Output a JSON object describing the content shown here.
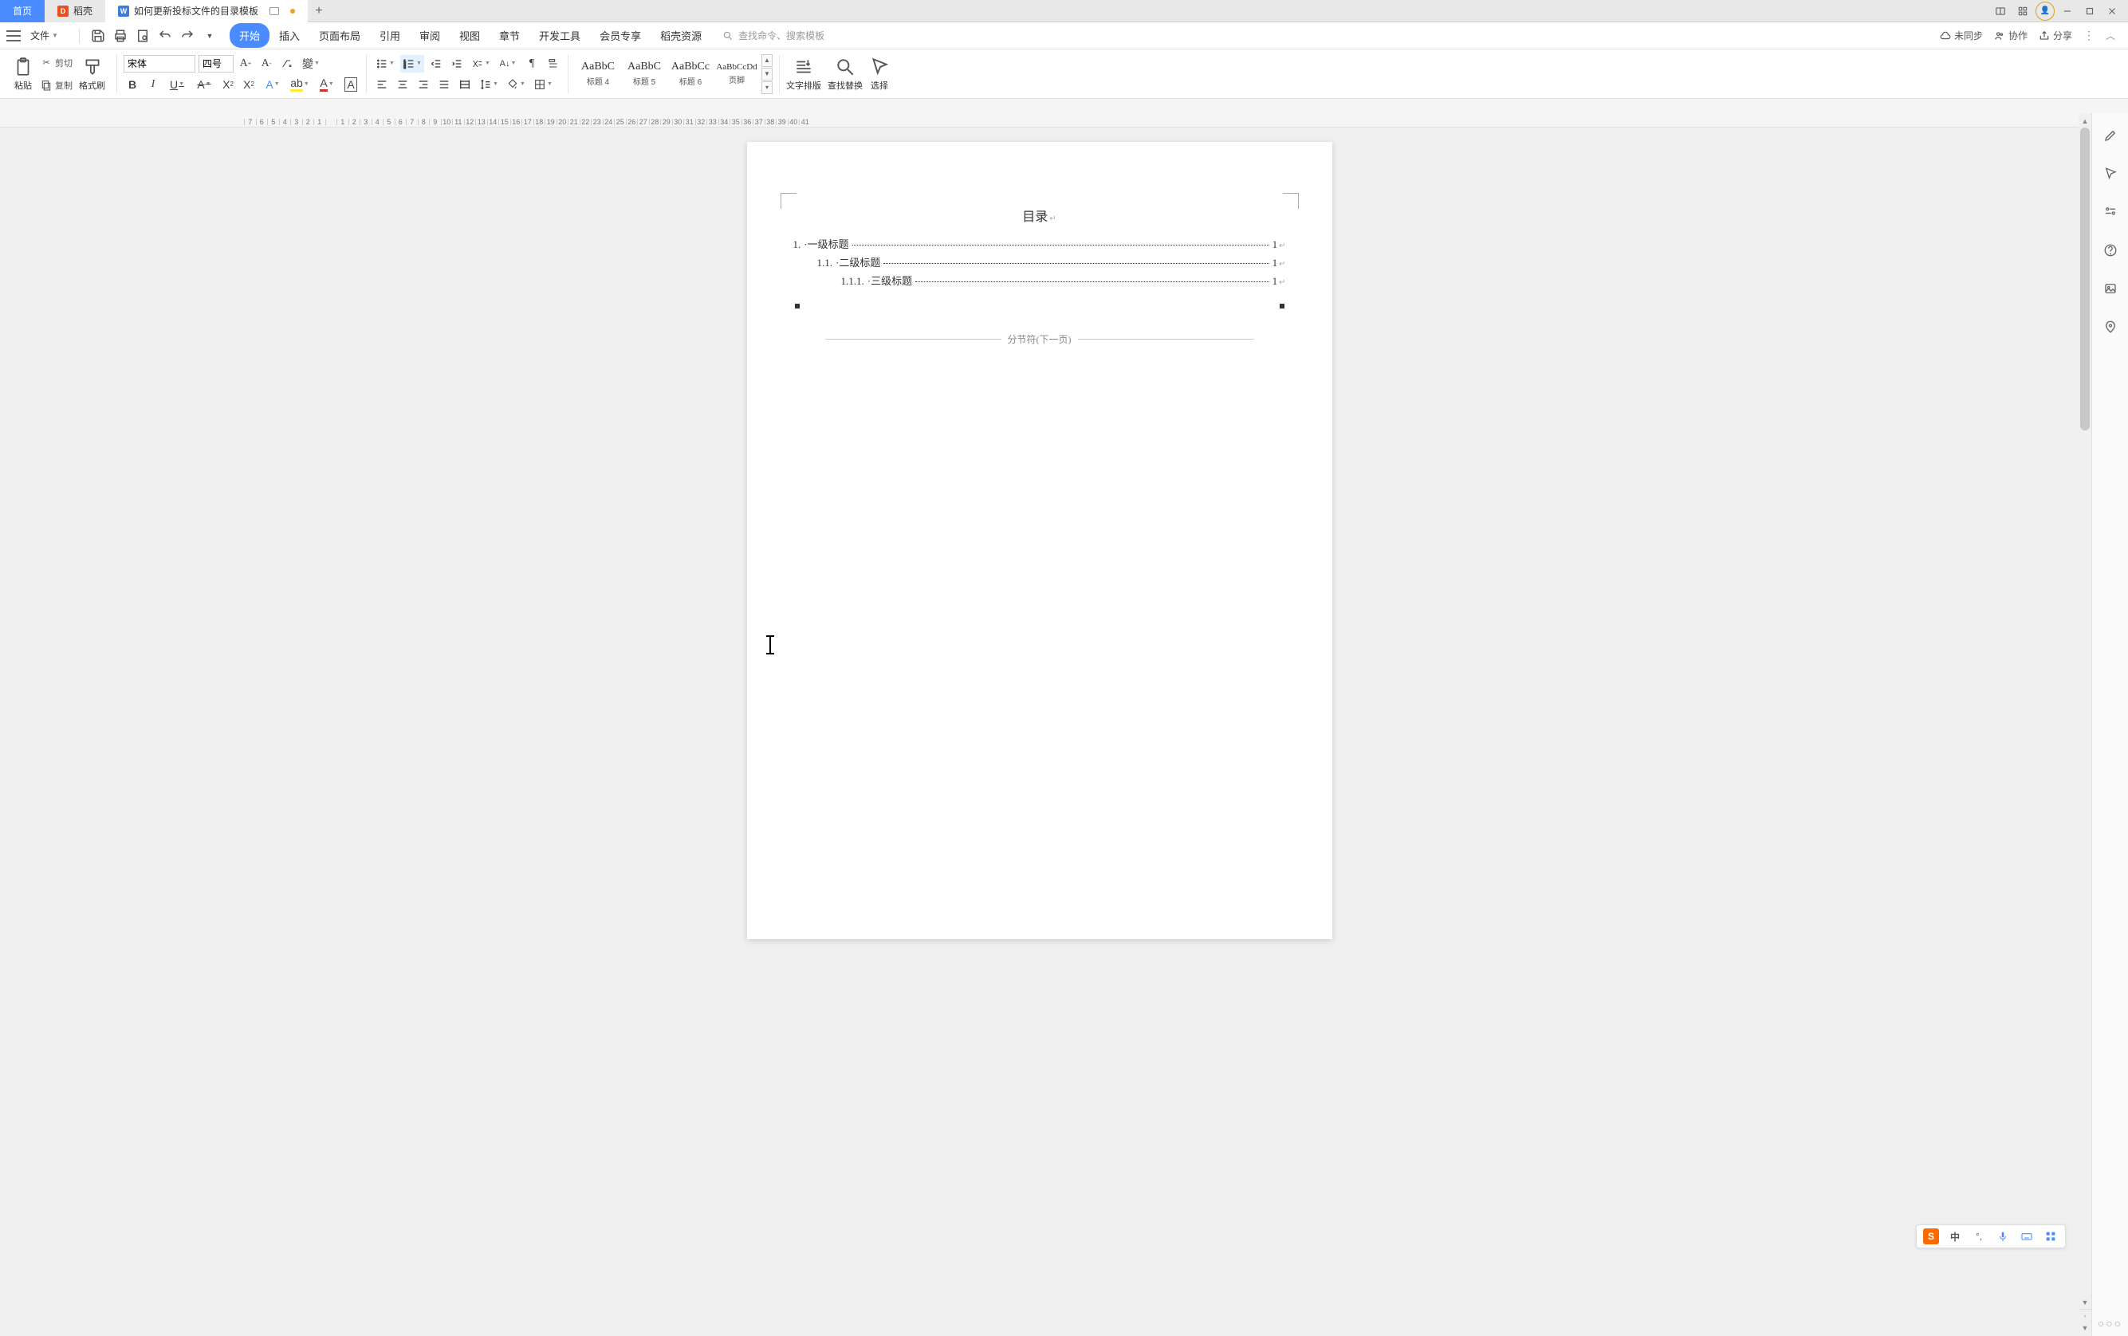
{
  "titlebar": {
    "home": "首页",
    "docer": "稻壳",
    "filename": "如何更新投标文件的目录模板",
    "add": "+"
  },
  "menubar": {
    "file": "文件",
    "tabs": [
      "开始",
      "插入",
      "页面布局",
      "引用",
      "审阅",
      "视图",
      "章节",
      "开发工具",
      "会员专享",
      "稻壳资源"
    ],
    "search_placeholder": "查找命令、搜索模板",
    "unsync": "未同步",
    "coop": "协作",
    "share": "分享"
  },
  "ribbon": {
    "paste": "粘贴",
    "cut": "剪切",
    "copy": "复制",
    "fmtpainter": "格式刷",
    "font_name": "宋体",
    "font_size": "四号",
    "styles": [
      {
        "prev": "AaBbC",
        "name": "标题 4"
      },
      {
        "prev": "AaBbC",
        "name": "标题 5"
      },
      {
        "prev": "AaBbCc",
        "name": "标题 6"
      },
      {
        "prev": "AaBbCcDd",
        "name": "页脚"
      }
    ],
    "textlayout": "文字排版",
    "findreplace": "查找替换",
    "select": "选择"
  },
  "ruler": [
    "7",
    "6",
    "5",
    "4",
    "3",
    "2",
    "1",
    "",
    "1",
    "2",
    "3",
    "4",
    "5",
    "6",
    "7",
    "8",
    "9",
    "10",
    "11",
    "12",
    "13",
    "14",
    "15",
    "16",
    "17",
    "18",
    "19",
    "20",
    "21",
    "22",
    "23",
    "24",
    "25",
    "26",
    "27",
    "28",
    "29",
    "30",
    "31",
    "32",
    "33",
    "34",
    "35",
    "36",
    "37",
    "38",
    "39",
    "40",
    "41"
  ],
  "doc": {
    "toc_title": "目录",
    "lines": [
      {
        "num": "1.",
        "txt": "·一级标题",
        "pg": "1"
      },
      {
        "num": "1.1.",
        "txt": "·二级标题",
        "pg": "1"
      },
      {
        "num": "1.1.1.",
        "txt": "·三级标题",
        "pg": "1"
      }
    ],
    "section_break": "分节符(下一页)"
  },
  "ime": {
    "zh": "中"
  }
}
